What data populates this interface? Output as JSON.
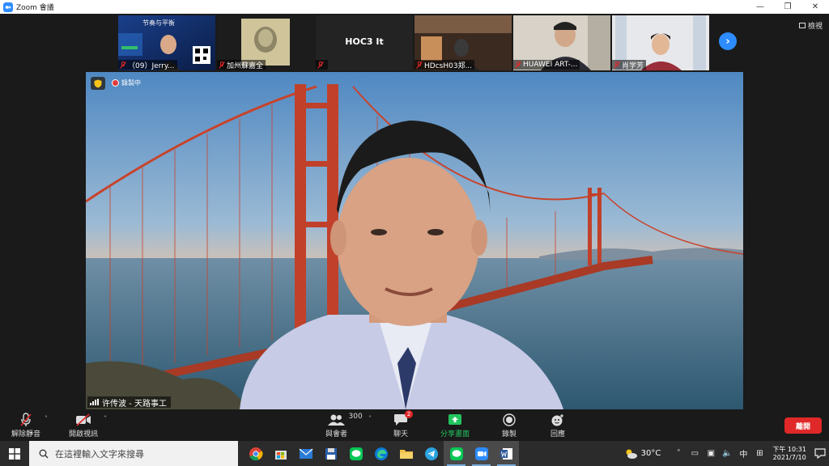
{
  "window": {
    "title": "Zoom 會議",
    "controls": {
      "minimize": "—",
      "restore": "❐",
      "close": "✕"
    }
  },
  "view_button": {
    "label": "檢視"
  },
  "participants": [
    {
      "name": "（09）Jerry...",
      "mic": "off",
      "banner": "节奏与平衡"
    },
    {
      "name": "加州蘇嘉全",
      "mic": "off"
    },
    {
      "name": "",
      "center_label": "HOC3 It",
      "mic": "off"
    },
    {
      "name": "HDcsH03郑...",
      "mic": "off"
    },
    {
      "name": "HUAWEI ART-...",
      "mic": "off"
    },
    {
      "name": "肖学芳",
      "mic": "off"
    }
  ],
  "main_video": {
    "recording_label": "錄製中",
    "speaker_name": "许传波 - 天路事工"
  },
  "toolbar": {
    "unmute": "解除靜音",
    "start_video": "開啟視訊",
    "participants_label": "與會者",
    "participants_count": "300",
    "chat": "聊天",
    "chat_badge": "2",
    "share": "分享畫面",
    "record": "錄製",
    "reactions": "回應",
    "leave": "離開"
  },
  "taskbar": {
    "search_placeholder": "在這裡輸入文字來搜尋",
    "temperature": "30°C",
    "ime": "中",
    "time": "下午 10:31",
    "date": "2021/7/10"
  },
  "colors": {
    "accent": "#2d8cff",
    "leave": "#e02828",
    "share": "#23c55e"
  }
}
